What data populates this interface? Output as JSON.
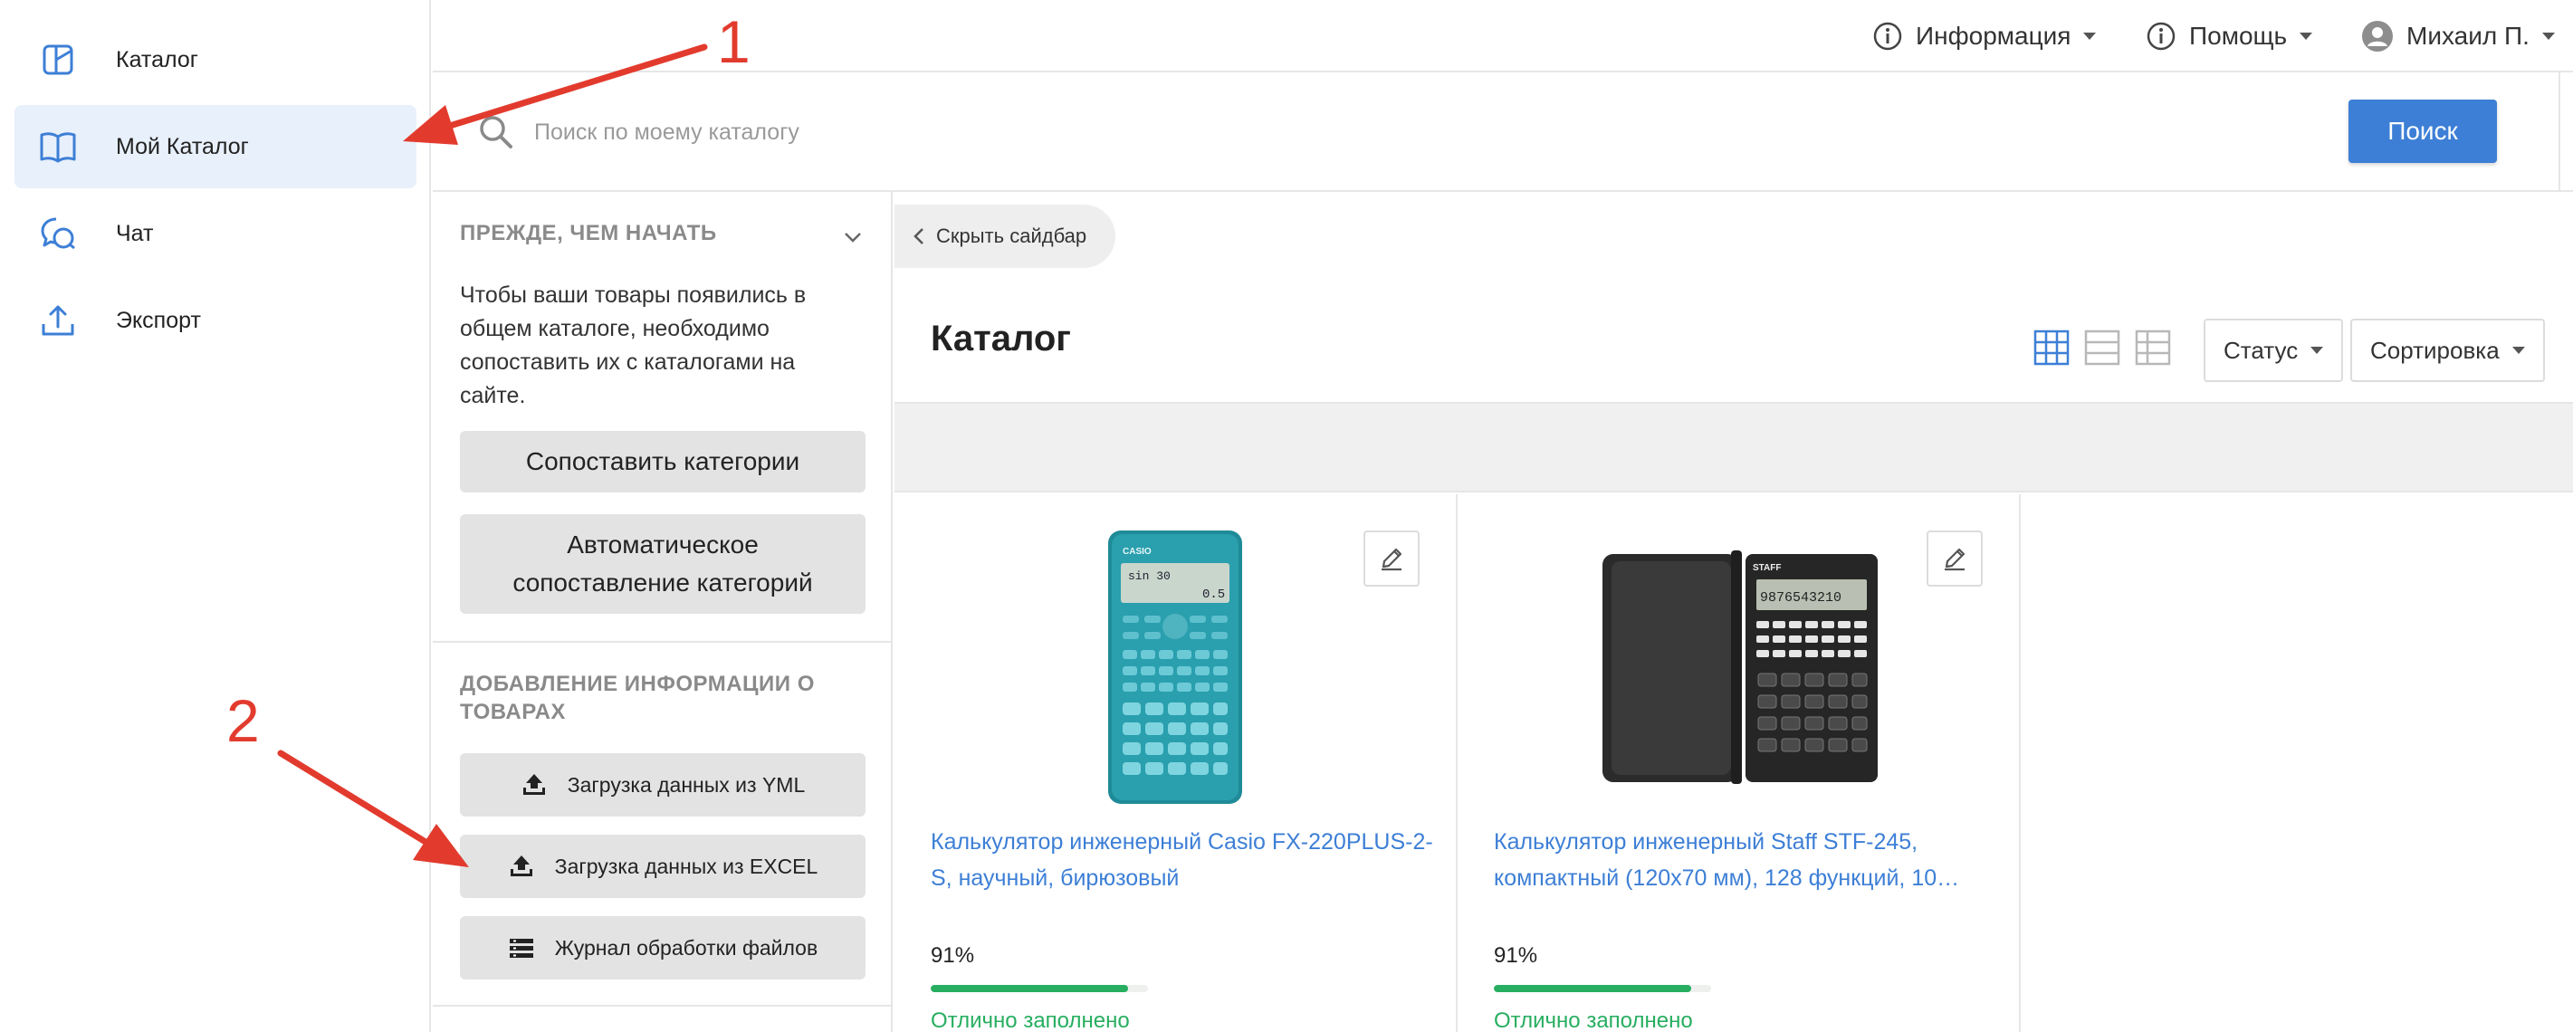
{
  "nav": {
    "items": [
      {
        "label": "Каталог",
        "icon": "catalog-icon",
        "active": false
      },
      {
        "label": "Мой Каталог",
        "icon": "book-icon",
        "active": true
      },
      {
        "label": "Чат",
        "icon": "chat-icon",
        "active": false
      },
      {
        "label": "Экспорт",
        "icon": "export-icon",
        "active": false
      }
    ]
  },
  "topbar": {
    "info_label": "Информация",
    "help_label": "Помощь",
    "user_label": "Михаил П."
  },
  "search": {
    "placeholder": "Поиск по моему каталогу",
    "value": "",
    "button_label": "Поиск"
  },
  "sidebar": {
    "section1": {
      "heading": "ПРЕЖДЕ, ЧЕМ НАЧАТЬ",
      "text": "Чтобы ваши товары появились в общем каталоге, необходимо сопоставить их с каталогами на сайте.",
      "map_button": "Сопоставить категории",
      "auto_button": "Автоматическое сопоставление категорий"
    },
    "section2": {
      "heading": "ДОБАВЛЕНИЕ ИНФОРМАЦИИ О ТОВАРАХ",
      "yml_button": "Загрузка данных из YML",
      "excel_button": "Загрузка данных из EXCEL",
      "log_button": "Журнал обработки файлов"
    }
  },
  "main": {
    "hide_sidebar_label": "Скрыть сайдбар",
    "title": "Каталог",
    "status_label": "Статус",
    "sort_label": "Сортировка",
    "products": [
      {
        "title": "Калькулятор инженерный Casio FX-220PLUS-2-S, научный, бирюзовый",
        "percent_text": "91%",
        "fill": 0.91,
        "status": "Отлично заполнено",
        "display_line1": "sin 30",
        "display_line2": "0.5",
        "brand": "CASIO"
      },
      {
        "title": "Калькулятор инженерный Staff STF-245, компактный (120х70 мм), 128 функций, 10…",
        "percent_text": "91%",
        "fill": 0.91,
        "status": "Отлично заполнено",
        "display_line1": "9876543210",
        "brand": "STAFF"
      }
    ]
  },
  "annotations": {
    "num1": "1",
    "num2": "2"
  },
  "colors": {
    "accent": "#3d7fd6",
    "active_nav_bg": "#e8f0fb",
    "success": "#27ae60",
    "annotation": "#e23b2e"
  }
}
